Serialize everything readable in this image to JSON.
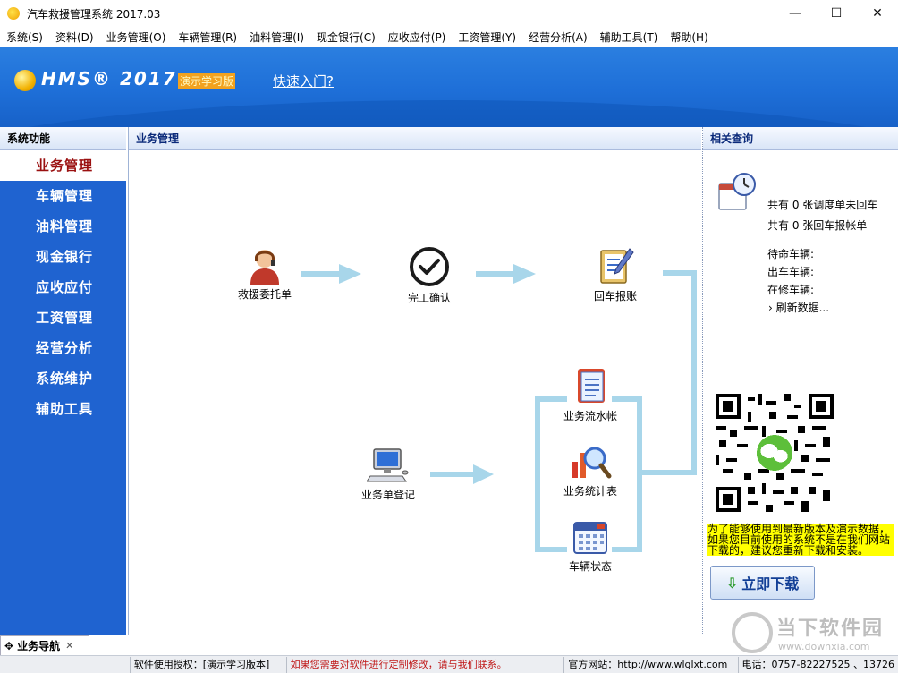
{
  "window": {
    "title": "汽车救援管理系统 2017.03",
    "controls": [
      "—",
      "☐",
      "✕"
    ]
  },
  "menu": [
    "系统(S)",
    "资料(D)",
    "业务管理(O)",
    "车辆管理(R)",
    "油料管理(I)",
    "现金银行(C)",
    "应收应付(P)",
    "工资管理(Y)",
    "经营分析(A)",
    "辅助工具(T)",
    "帮助(H)"
  ],
  "banner": {
    "logo": "HMS® 2017",
    "demo_badge": "演示学习版",
    "quick_link": "快速入门?"
  },
  "left_panel": {
    "header": "系统功能",
    "items": [
      "业务管理",
      "车辆管理",
      "油料管理",
      "现金银行",
      "应收应付",
      "工资管理",
      "经营分析",
      "系统维护",
      "辅助工具"
    ],
    "active_index": 0
  },
  "center_panel": {
    "header": "业务管理",
    "nodes": {
      "rescue_order": "救援委托单",
      "completion": "完工确认",
      "return_reimburse": "回车报账",
      "business_ledger": "业务流水帐",
      "business_stats": "业务统计表",
      "vehicle_status": "车辆状态",
      "order_register": "业务单登记"
    },
    "accent_color": "#a8d6ea"
  },
  "right_panel": {
    "header": "相关查询",
    "info": [
      "共有 0 张调度单未回车",
      "共有 0 张回车报帐单"
    ],
    "vehicles": [
      "待命车辆:",
      "出车车辆:",
      "在修车辆:"
    ],
    "refresh": "› 刷新数据...",
    "notice": "为了能够使用到最新版本及演示数据，如果您目前使用的系统不是在我们网站下载的，建议您重新下载和安装。",
    "download_btn": "立即下载",
    "download_icon": "download-arrow-icon"
  },
  "bottom": {
    "nav_tab": "业务导航",
    "status": [
      "",
      "软件使用授权：[演示学习版本]",
      "如果您需要对软件进行定制修改，请与我们联系。",
      "官方网站：http://www.wlglxt.com",
      "电话：0757-82227525 、13726"
    ]
  },
  "watermark": {
    "text": "当下软件园",
    "url": "www.downxia.com"
  }
}
